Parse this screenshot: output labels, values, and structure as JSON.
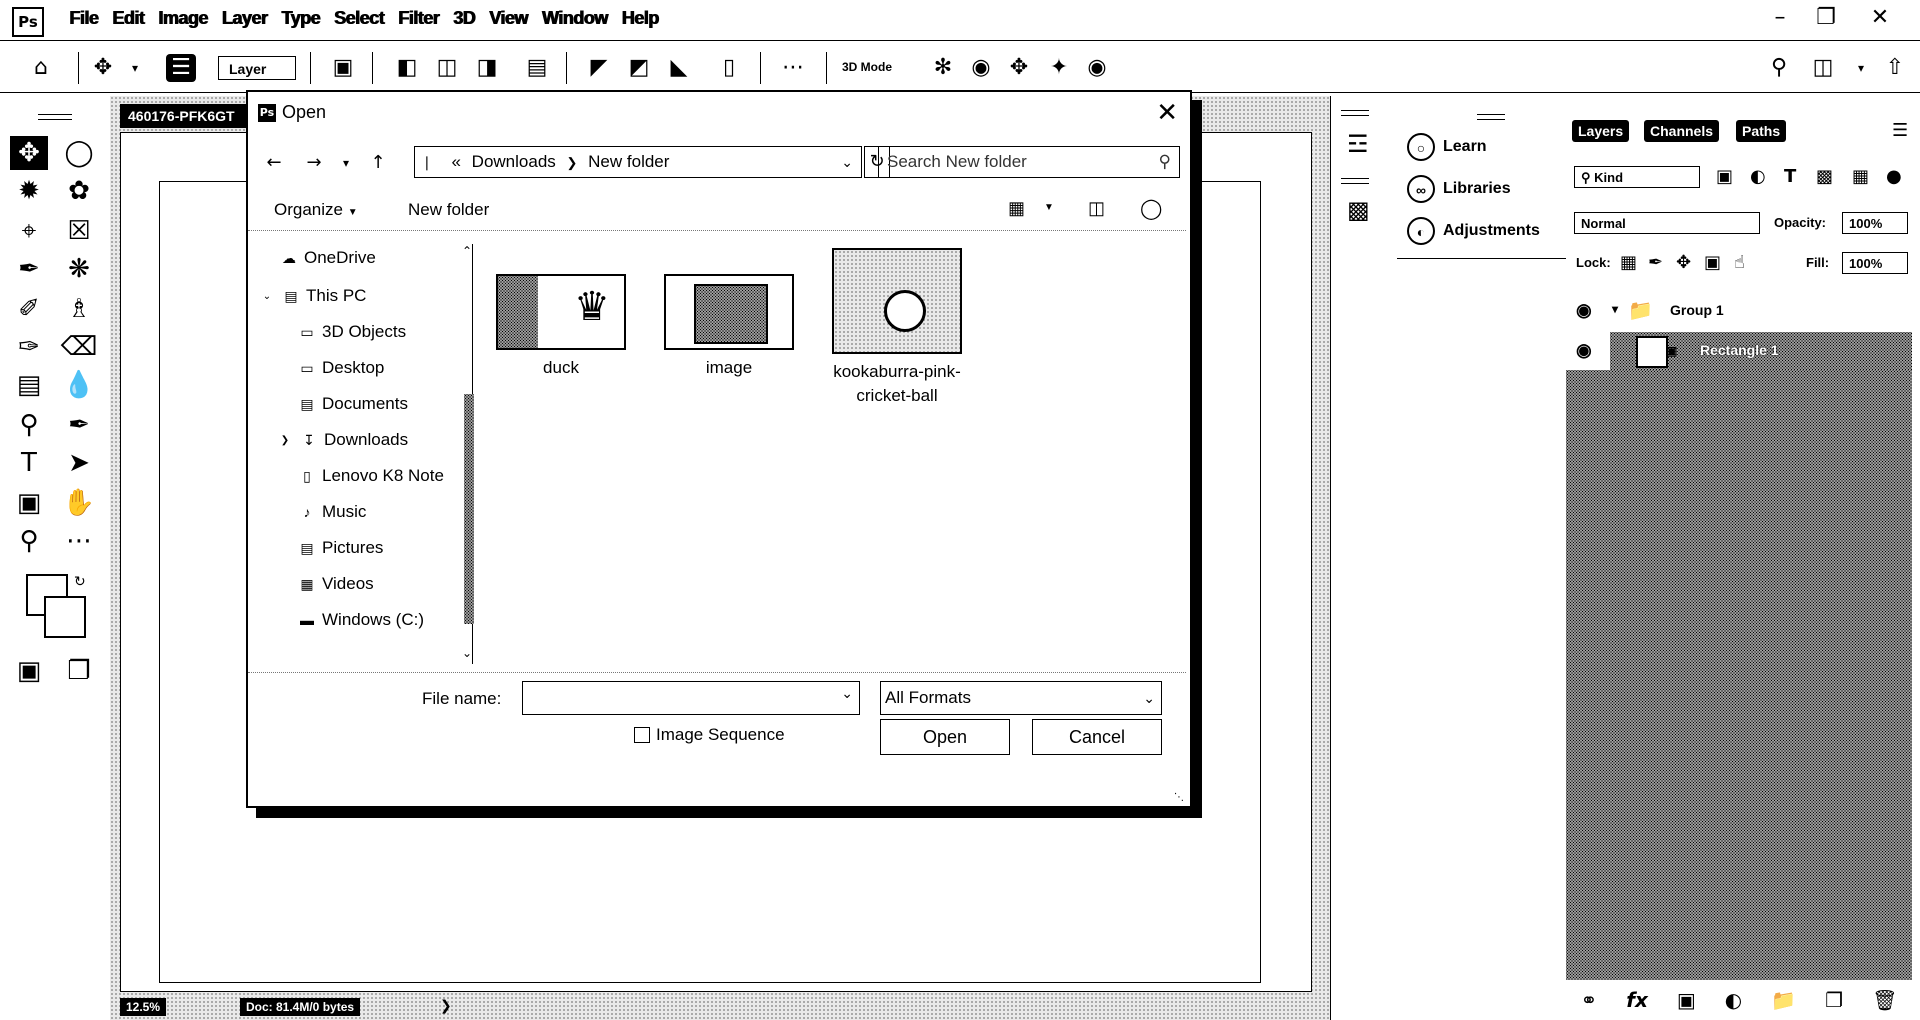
{
  "app": {
    "logo": "Ps"
  },
  "menu": [
    "File",
    "Edit",
    "Image",
    "Layer",
    "Type",
    "Select",
    "Filter",
    "3D",
    "View",
    "Window",
    "Help"
  ],
  "options": {
    "layer_select": "Layer",
    "mode_label": "3D Mode"
  },
  "document": {
    "tab_title": "460176-PFK6GT",
    "zoom": "12.5%",
    "doc_info": "Doc: 81.4M/0 bytes"
  },
  "mid_panel": {
    "learn": "Learn",
    "libraries": "Libraries",
    "adjustments": "Adjustments"
  },
  "layers_panel": {
    "tabs": [
      "Layers",
      "Channels",
      "Paths"
    ],
    "filter_kind": "Kind",
    "blend_mode": "Normal",
    "opacity_label": "Opacity:",
    "opacity_value": "100%",
    "lock_label": "Lock:",
    "fill_label": "Fill:",
    "fill_value": "100%",
    "layers": [
      {
        "name": "Group 1",
        "type": "group"
      },
      {
        "name": "Rectangle 1",
        "type": "shape"
      }
    ]
  },
  "dialog": {
    "title": "Open",
    "breadcrumb": [
      "Downloads",
      "New folder"
    ],
    "search_placeholder": "Search New folder",
    "organize": "Organize",
    "new_folder": "New folder",
    "nav_items": [
      {
        "label": "OneDrive",
        "icon": "cloud-icon"
      },
      {
        "label": "This PC",
        "icon": "computer-icon"
      },
      {
        "label": "3D Objects",
        "icon": "cube-icon"
      },
      {
        "label": "Desktop",
        "icon": "desktop-icon"
      },
      {
        "label": "Documents",
        "icon": "document-icon"
      },
      {
        "label": "Downloads",
        "icon": "download-icon"
      },
      {
        "label": "Lenovo K8 Note",
        "icon": "phone-icon"
      },
      {
        "label": "Music",
        "icon": "music-icon"
      },
      {
        "label": "Pictures",
        "icon": "picture-icon"
      },
      {
        "label": "Videos",
        "icon": "video-icon"
      },
      {
        "label": "Windows (C:)",
        "icon": "drive-icon"
      }
    ],
    "files": [
      {
        "name": "duck"
      },
      {
        "name": "image"
      },
      {
        "name": "kookaburra-pink-cricket-ball"
      }
    ],
    "file_name_label": "File name:",
    "file_name_value": "",
    "format": "All Formats",
    "image_sequence": "Image Sequence",
    "open_button": "Open",
    "cancel_button": "Cancel"
  }
}
